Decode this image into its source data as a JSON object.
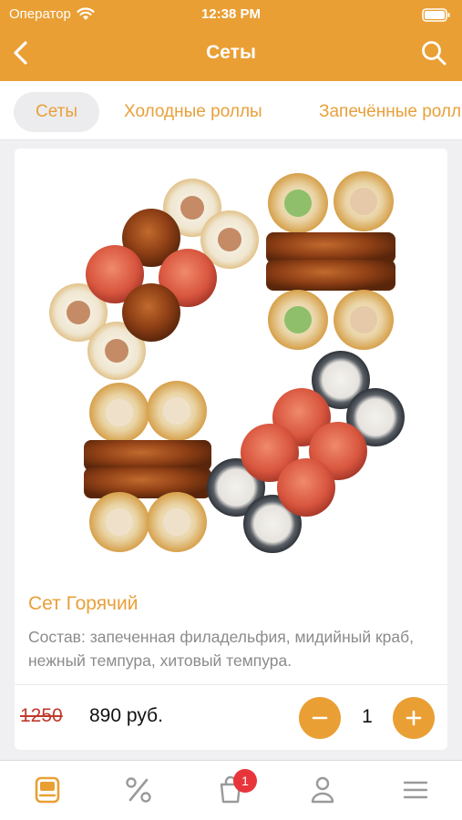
{
  "status_bar": {
    "carrier": "Оператор",
    "time": "12:38 PM"
  },
  "nav": {
    "title": "Сеты"
  },
  "tabs": [
    {
      "label": "Сеты",
      "active": true
    },
    {
      "label": "Холодные роллы",
      "active": false
    },
    {
      "label": "Запечённые роллы",
      "active": false
    }
  ],
  "product": {
    "title": "Сет Горячий",
    "description": "Состав: запеченная филадельфия, мидийный краб, нежный темпура, хитовый темпура.",
    "old_price": "1250",
    "price": "890 руб.",
    "quantity": "1"
  },
  "tab_bar": {
    "items": [
      "menu-icon",
      "percent-icon",
      "cart-icon",
      "profile-icon",
      "hamburger-icon"
    ],
    "cart_badge": "1"
  },
  "colors": {
    "accent": "#ea9f34",
    "badge": "#e8353b",
    "price_strike": "#c0392b"
  }
}
